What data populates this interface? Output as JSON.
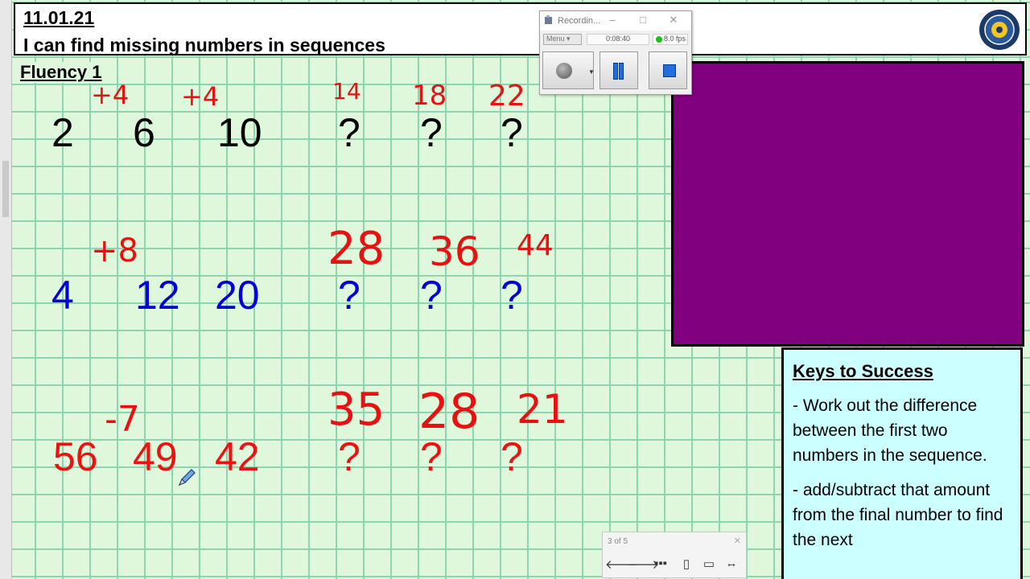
{
  "header": {
    "date": "11.01.21",
    "objective": "I can find missing numbers in sequences"
  },
  "fluency_label": "Fluency 1",
  "sequences": [
    {
      "color": "#000000",
      "values": [
        "2",
        "6",
        "10",
        "?",
        "?",
        "?"
      ]
    },
    {
      "color": "#0000dd",
      "values": [
        "4",
        "12",
        "20",
        "?",
        "?",
        "?"
      ]
    },
    {
      "color": "#ee1111",
      "values": [
        "56",
        "49",
        "42",
        "?",
        "?",
        "?"
      ]
    }
  ],
  "annotations": {
    "row1": [
      "+4",
      "+4",
      "14",
      "18",
      "22"
    ],
    "row2": [
      "+8",
      "28",
      "36",
      "44"
    ],
    "row3": [
      "-7",
      "35",
      "28",
      "21"
    ],
    "ink_color": "#e81010"
  },
  "keys_to_success": {
    "title": "Keys to Success",
    "points": [
      "- Work out the difference between the first two numbers in the sequence.",
      "- add/subtract that amount from the final number to find the next"
    ]
  },
  "recording_window": {
    "title": "Recordin...",
    "menu_label": "Menu",
    "timer": "0:08:40",
    "fps": "8.0 fps"
  },
  "navigation": {
    "page_indicator": "3 of 5"
  },
  "icons": [
    "logo-icon",
    "record-icon",
    "pause-icon",
    "stop-icon",
    "pen-cursor-icon",
    "arrow-left-icon",
    "arrow-right-icon"
  ],
  "colors": {
    "grid_background": "#dff8dc",
    "grid_lines": "#8dd4b0",
    "purple_box": "#800080",
    "keys_background": "#ccffff"
  }
}
